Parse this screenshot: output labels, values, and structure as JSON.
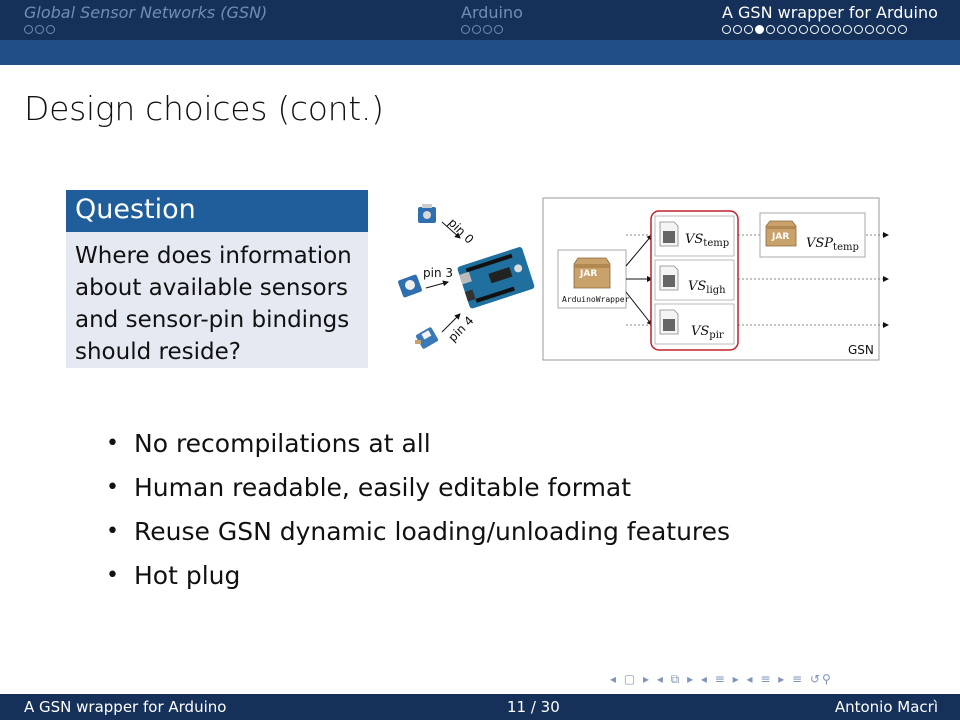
{
  "header": {
    "sections": [
      {
        "label": "Global Sensor Networks (GSN)",
        "dots": 3,
        "active_dot": null,
        "current": false
      },
      {
        "label": "Arduino",
        "dots": 4,
        "active_dot": null,
        "current": false
      },
      {
        "label": "A GSN wrapper for Arduino",
        "dots": 17,
        "active_dot": 4,
        "current": true
      }
    ]
  },
  "slide": {
    "title": "Design choices (cont.)",
    "block": {
      "title": "Question",
      "body": "Where does information about available sensors and sensor-pin bindings should reside?"
    },
    "diagram": {
      "pins": [
        "pin 0",
        "pin 3",
        "pin 4"
      ],
      "jar_label": "JAR",
      "wrapper_label": "ArduinoWrapper",
      "vs_temp": {
        "base": "VS",
        "sub": "temp"
      },
      "vs_ligh": {
        "base": "VS",
        "sub": "ligh"
      },
      "vs_pir": {
        "base": "VS",
        "sub": "pir"
      },
      "vsp_temp": {
        "base": "VSP",
        "sub": "temp"
      },
      "gsn_label": "GSN",
      "highlight_color": "#c0202a"
    },
    "bullets": [
      "No recompilations at all",
      "Human readable, easily editable format",
      "Reuse GSN dynamic loading/unloading features",
      "Hot plug"
    ]
  },
  "footer": {
    "title": "A GSN wrapper for Arduino",
    "page": "11 / 30",
    "author": "Antonio Macrì"
  },
  "colors": {
    "header_dark": "#15315a",
    "header_band": "#1f4f86",
    "block_title": "#1f5e9a",
    "block_body": "#e5e9f2"
  }
}
